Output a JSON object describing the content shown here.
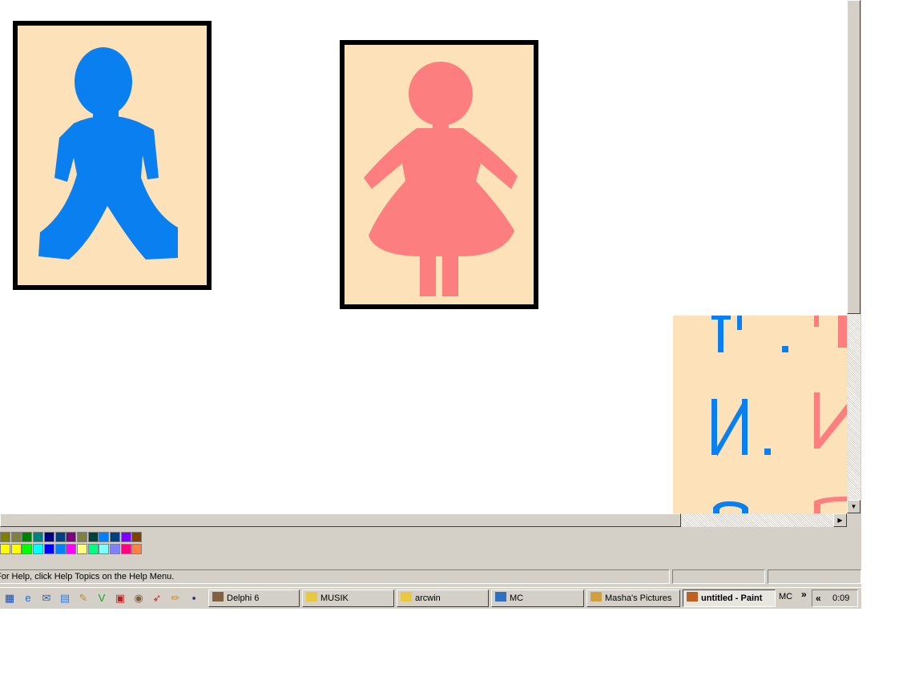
{
  "status_bar": {
    "help_text": "For Help, click Help Topics on the Help Menu.",
    "coordinates": "",
    "selection_size": ""
  },
  "palette": {
    "row1": [
      "#808000",
      "#808040",
      "#008000",
      "#008080",
      "#000080",
      "#004080",
      "#800080",
      "#808040",
      "#004040",
      "#0080ff",
      "#004080",
      "#8000ff",
      "#804000"
    ],
    "row2": [
      "#ffff00",
      "#ffff00",
      "#00ff00",
      "#00ffff",
      "#0000ff",
      "#0080ff",
      "#ff00ff",
      "#ffff80",
      "#00ff80",
      "#80ffff",
      "#8080ff",
      "#ff0080",
      "#ff8040"
    ]
  },
  "canvas": {
    "background": "#fde1b9",
    "boy_color": "#0a7ff0",
    "girl_color": "#fc7e7e",
    "letters_blue": [
      "Ф.",
      "И.",
      "О"
    ],
    "letters_pink": [
      "Ф",
      "И",
      "О"
    ]
  },
  "taskbar": {
    "quick_launch": [
      "desktop-icon",
      "ie-icon",
      "outlook-icon",
      "notepad-icon",
      "tools-icon",
      "v-icon",
      "app-icon",
      "delphi-icon",
      "bird-icon",
      "pencil-icon",
      "save-icon"
    ],
    "tasks": [
      {
        "label": "Delphi 6",
        "icon": "delphi-icon",
        "active": false
      },
      {
        "label": "MUSIK",
        "icon": "folder-icon",
        "active": false
      },
      {
        "label": "arcwin",
        "icon": "folder-icon",
        "active": false
      },
      {
        "label": "MC",
        "icon": "mc-icon",
        "active": false
      },
      {
        "label": "Masha's Pictures",
        "icon": "pictures-icon",
        "active": false
      },
      {
        "label": "untitled - Paint",
        "icon": "paint-icon",
        "active": true
      }
    ],
    "language": "MC",
    "language_more": "»",
    "tray_expand": "«",
    "clock": "0:09"
  }
}
